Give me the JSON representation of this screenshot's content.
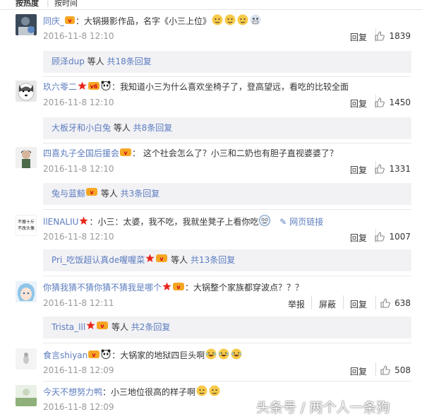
{
  "sort": {
    "tab_hot": "按热度",
    "separator": "|",
    "tab_time": "按时间"
  },
  "actions": {
    "reply": "回复",
    "report": "举报",
    "block": "屏蔽"
  },
  "comments": [
    {
      "user": "同庆_",
      "text": "：大锅摄影作品，名字《小三上位》",
      "date": "2016-11-8 12:10",
      "likes": "1839",
      "reply": {
        "names": "顾泽dup",
        "mid": " 等人 ",
        "count": "共18条回复"
      }
    },
    {
      "user": "玖六零二",
      "text": "：我知道小三为什么喜欢坐椅子了，登高望远，看吃的比较全面",
      "date": "2016-11-8 12:10",
      "likes": "1450",
      "reply": {
        "names": "大板牙和小白兔",
        "mid": " 等人 ",
        "count": "共8条回复"
      }
    },
    {
      "user": "四喜丸子全国后援会",
      "text": "： 这个社会怎么了？小三和二奶也有胆子直视婆婆了？",
      "date": "2016-11-8 12:10",
      "likes": "1331",
      "reply": {
        "names": "兔与蓝鲸",
        "mid": " 等人 ",
        "count": "共3条回复"
      }
    },
    {
      "user": "llENALIU",
      "text": "：小三：太婆，我不吃，我就坐凳子上看你吃",
      "link": "网页链接",
      "date": "2016-11-8 12:10",
      "likes": "1007",
      "avatar_text": [
        "不瘦十斤",
        "不改头像"
      ],
      "reply": {
        "names": "Pri_吃饭超认真de喔喔菜",
        "mid": " 等人 ",
        "count": "共13条回复"
      }
    },
    {
      "user": "你猜我猜不猜你猜不猜我是哪个",
      "text": "：大锅整个家族都穿波点？？？",
      "date": "2016-11-8 12:11",
      "likes": "638",
      "reply": {
        "names": "Trista_lll",
        "mid": " 等人 ",
        "count": "共2条回复"
      }
    },
    {
      "user": "食言shiyan",
      "text": "：大锅家的地狱四巨头啊",
      "date": "2016-11-8 12:09",
      "likes": "508"
    },
    {
      "user": "今天不想努力鸭",
      "text": "：小三地位很高的样子啊",
      "date": "2016-11-8 12:09"
    }
  ],
  "watermark": "头条号 / 两个人一条狗",
  "colors": {
    "link": "#5c7cbf",
    "date": "#999999",
    "reply_bg": "#f2f2f5",
    "star": "#e8261a",
    "badge": "#f5a623"
  }
}
